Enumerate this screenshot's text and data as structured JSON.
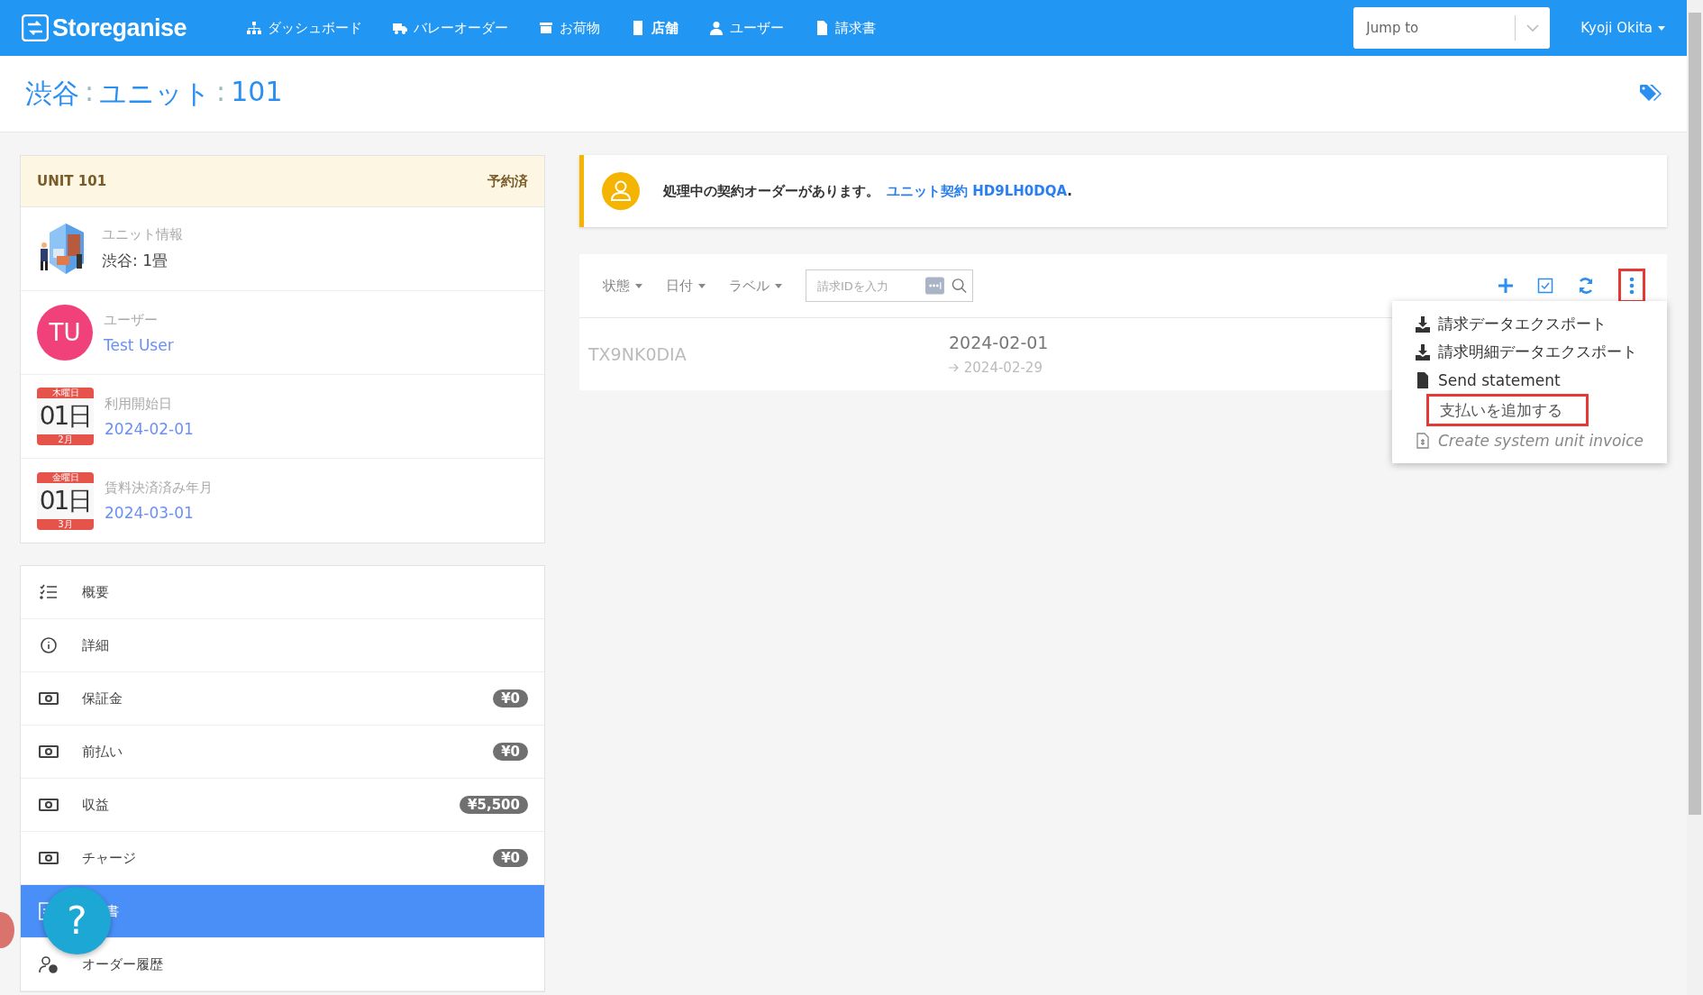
{
  "navbar": {
    "brand": "Storeganise",
    "items": [
      {
        "label": "ダッシュボード",
        "selected": false
      },
      {
        "label": "バレーオーダー",
        "selected": false
      },
      {
        "label": "お荷物",
        "selected": false
      },
      {
        "label": "店舗",
        "selected": true
      },
      {
        "label": "ユーザー",
        "selected": false
      },
      {
        "label": "請求書",
        "selected": false
      }
    ],
    "jump": {
      "placeholder": "Jump to"
    },
    "user": "Kyoji Okita"
  },
  "breadcrumb": [
    "渋谷",
    ":",
    "ユニット",
    ":",
    "101"
  ],
  "unit_card": {
    "title": "UNIT 101",
    "status": "予約済",
    "rows": [
      {
        "kind": "image",
        "label": "ユニット情報",
        "value": "渋谷: 1畳"
      },
      {
        "kind": "avatar",
        "initials": "TU",
        "label": "ユーザー",
        "value": "Test User"
      },
      {
        "kind": "calendar",
        "weekday": "木曜日",
        "day": "01日",
        "month": "2月",
        "label": "利用開始日",
        "value": "2024-02-01"
      },
      {
        "kind": "calendar",
        "weekday": "金曜日",
        "day": "01日",
        "month": "3月",
        "label": "賃料決済済み年月",
        "value": "2024-03-01"
      }
    ]
  },
  "side_menu": [
    {
      "label": "概要",
      "selected": false
    },
    {
      "label": "詳細",
      "selected": false
    },
    {
      "label": "保証金",
      "badge": "¥0",
      "selected": false
    },
    {
      "label": "前払い",
      "badge": "¥0",
      "selected": false
    },
    {
      "label": "収益",
      "badge": "¥5,500",
      "selected": false
    },
    {
      "label": "チャージ",
      "badge": "¥0",
      "selected": false
    },
    {
      "label": "書",
      "selected": true
    },
    {
      "label": "オーダー履歴",
      "selected": false
    }
  ],
  "help_button": "?",
  "alert": {
    "text": "処理中の契約オーダーがあります。",
    "link": "ユニット契約 HD9LH0DQA",
    "suffix": "."
  },
  "filters": [
    "状態",
    "日付",
    "ラベル"
  ],
  "search": {
    "placeholder": "請求IDを入力"
  },
  "toolbar": {
    "kebab_highlighted": true
  },
  "invoices": [
    {
      "id": "TX9NK0DIA",
      "start": "2024-02-01",
      "end": "2024-02-29"
    }
  ],
  "dropdown": [
    {
      "label": "請求データエクスポート",
      "italic": false,
      "highlighted": false
    },
    {
      "label": "請求明細データエクスポート",
      "italic": false,
      "highlighted": false
    },
    {
      "label": "Send statement",
      "italic": false,
      "highlighted": false
    },
    {
      "label": "支払いを追加する",
      "italic": false,
      "highlighted": true
    },
    {
      "label": "Create system unit invoice",
      "italic": true,
      "highlighted": false
    }
  ]
}
